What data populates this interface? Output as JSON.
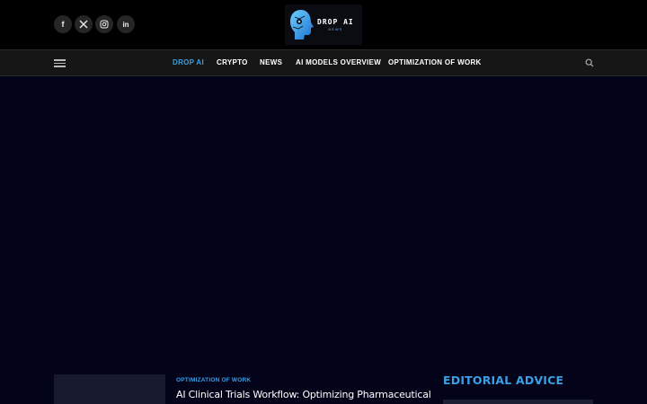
{
  "header": {
    "social": [
      {
        "name": "facebook",
        "glyph": "f"
      },
      {
        "name": "x",
        "glyph": "𝕏"
      },
      {
        "name": "instagram",
        "glyph": "◎"
      },
      {
        "name": "linkedin",
        "glyph": "in"
      }
    ],
    "logo": {
      "title": "DROP AI",
      "subtitle": "NEWS"
    }
  },
  "nav": {
    "items": [
      "DROP AI",
      "CRYPTO",
      "NEWS",
      "AI MODELS OVERVIEW",
      "OPTIMIZATION OF WORK"
    ],
    "active_index": 0
  },
  "post": {
    "category": "OPTIMIZATION OF WORK",
    "title": "AI Clinical Trials Workflow: Optimizing Pharmaceutical"
  },
  "sidebar": {
    "title": "EDITORIAL ADVICE"
  },
  "colors": {
    "accent": "#3aa0e6",
    "background": "#03031a",
    "topbar": "#000000",
    "navbar": "#161616"
  }
}
